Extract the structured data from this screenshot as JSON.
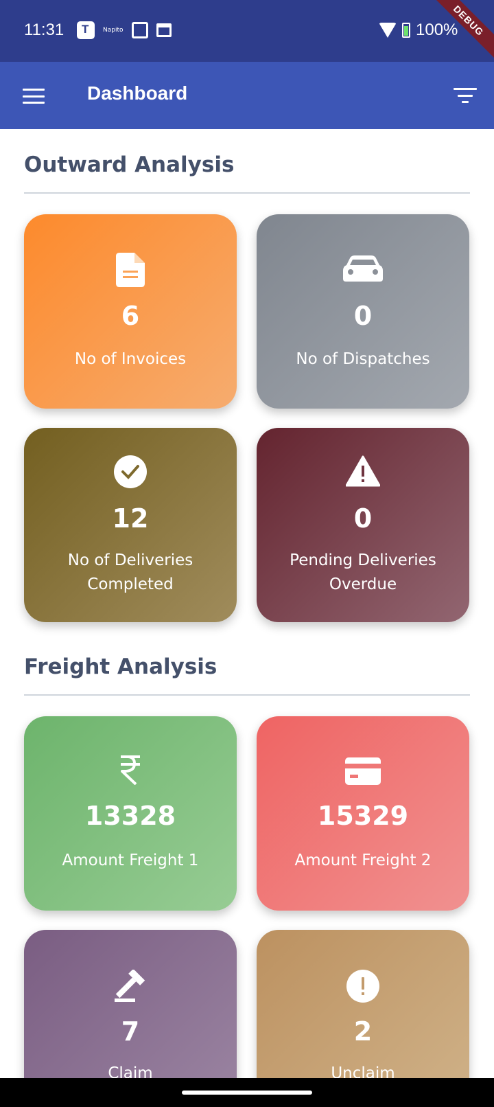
{
  "status_bar": {
    "time": "11:31",
    "napito": "Napito",
    "battery_percent": "100%",
    "debug_label": "DEBUG"
  },
  "app_bar": {
    "title": "Dashboard"
  },
  "outward": {
    "title": "Outward Analysis",
    "cards": [
      {
        "value": "6",
        "label": "No of Invoices",
        "icon": "document-icon",
        "color_from": "#fd8a2c",
        "color_to": "#f6ac6f"
      },
      {
        "value": "0",
        "label": "No of Dispatches",
        "icon": "car-icon",
        "color_from": "#80868f",
        "color_to": "#a3a8af"
      },
      {
        "value": "12",
        "label": "No of Deliveries Completed",
        "icon": "check-circle-icon",
        "color_from": "#735f20",
        "color_to": "#a08c5c"
      },
      {
        "value": "0",
        "label": "Pending Deliveries Overdue",
        "icon": "warning-icon",
        "color_from": "#64242f",
        "color_to": "#926671"
      }
    ]
  },
  "freight": {
    "title": "Freight Analysis",
    "cards": [
      {
        "value": "13328",
        "label": "Amount Freight 1",
        "icon": "rupee-icon",
        "color_from": "#6db46c",
        "color_to": "#97cc94"
      },
      {
        "value": "15329",
        "label": "Amount Freight 2",
        "icon": "credit-card-icon",
        "color_from": "#ef6463",
        "color_to": "#f09190"
      },
      {
        "value": "7",
        "label": "Claim",
        "icon": "gavel-icon",
        "color_from": "#7a5d82",
        "color_to": "#9c86a3"
      },
      {
        "value": "2",
        "label": "Unclaim",
        "icon": "alert-circle-icon",
        "color_from": "#bc9160",
        "color_to": "#d0b38a"
      }
    ]
  }
}
